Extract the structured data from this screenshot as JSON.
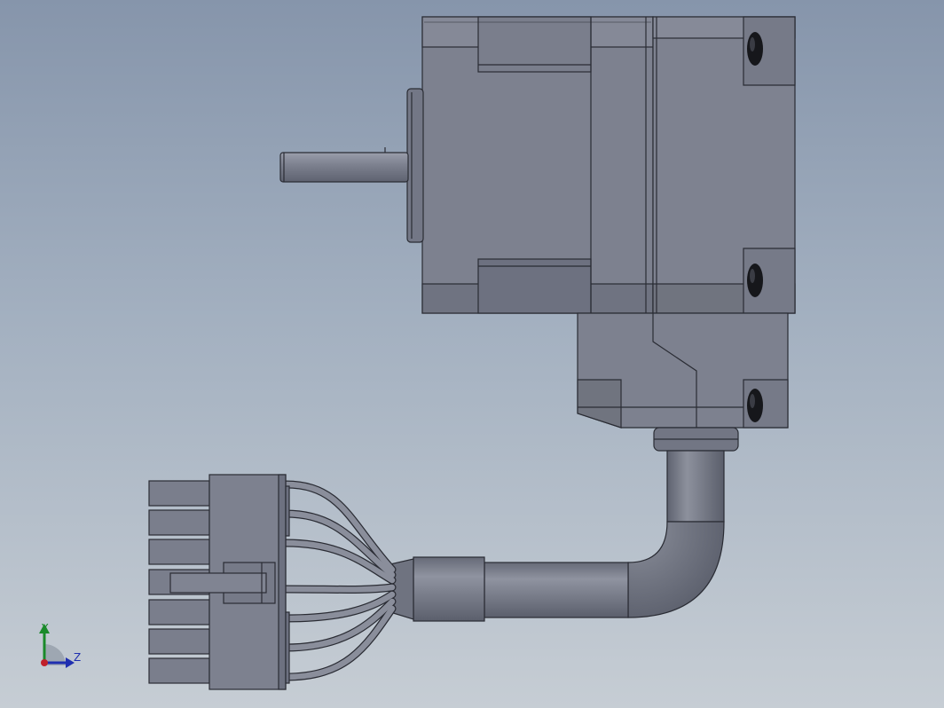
{
  "viewport": {
    "background_top": "#8695ab",
    "background_bottom": "#c6cdd4"
  },
  "model": {
    "body_color": "#7d818f",
    "edge_color": "#2a2c34",
    "cable_color": "#7a7e8c"
  },
  "triad": {
    "y_label": "Y",
    "z_label": "Z",
    "y_color": "#1a8a2a",
    "z_color": "#1f2fb0",
    "origin_color": "#c0202a"
  }
}
